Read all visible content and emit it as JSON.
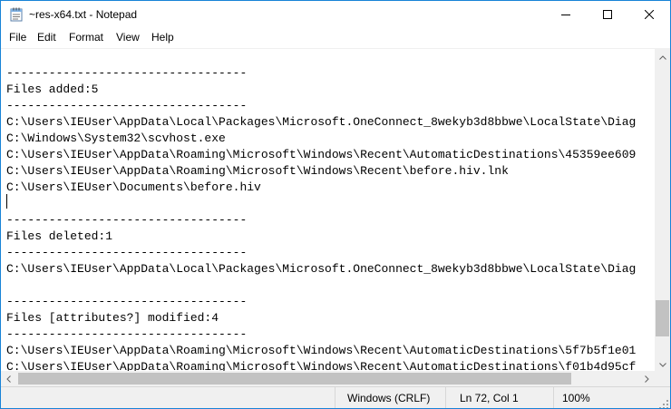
{
  "window": {
    "title": "~res-x64.txt - Notepad",
    "app_icon": "notepad-icon"
  },
  "controls": {
    "minimize_icon": "minimize-icon",
    "maximize_icon": "maximize-icon",
    "close_icon": "close-icon"
  },
  "menu": {
    "items": [
      "File",
      "Edit",
      "Format",
      "View",
      "Help"
    ]
  },
  "editor": {
    "lines": [
      "----------------------------------",
      "Files added:5",
      "----------------------------------",
      "C:\\Users\\IEUser\\AppData\\Local\\Packages\\Microsoft.OneConnect_8wekyb3d8bbwe\\LocalState\\Diag",
      "C:\\Windows\\System32\\scvhost.exe",
      "C:\\Users\\IEUser\\AppData\\Roaming\\Microsoft\\Windows\\Recent\\AutomaticDestinations\\45359ee609",
      "C:\\Users\\IEUser\\AppData\\Roaming\\Microsoft\\Windows\\Recent\\before.hiv.lnk",
      "C:\\Users\\IEUser\\Documents\\before.hiv",
      "",
      "----------------------------------",
      "Files deleted:1",
      "----------------------------------",
      "C:\\Users\\IEUser\\AppData\\Local\\Packages\\Microsoft.OneConnect_8wekyb3d8bbwe\\LocalState\\Diag",
      "",
      "----------------------------------",
      "Files [attributes?] modified:4",
      "----------------------------------",
      "C:\\Users\\IEUser\\AppData\\Roaming\\Microsoft\\Windows\\Recent\\AutomaticDestinations\\5f7b5f1e01",
      "C:\\Users\\IEUser\\AppData\\Roaming\\Microsoft\\Windows\\Recent\\AutomaticDestinations\\f01b4d95cf"
    ]
  },
  "status": {
    "line_ending": "Windows (CRLF)",
    "position": "Ln 72, Col 1",
    "zoom": "100%"
  }
}
